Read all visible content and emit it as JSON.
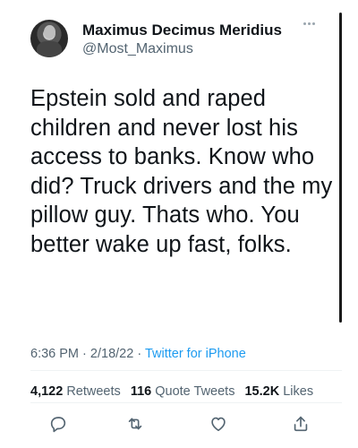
{
  "author": {
    "display_name": "Maximus Decimus Meridius",
    "handle": "@Most_Maximus"
  },
  "tweet": {
    "text": "Epstein sold and raped children and never lost his access to banks. Know who did? Truck drivers and the my pillow guy. Thats who. You better wake up fast, folks.",
    "time": "6:36 PM",
    "date": "2/18/22",
    "separator": "·",
    "source": "Twitter for iPhone"
  },
  "stats": {
    "retweets_count": "4,122",
    "retweets_label": "Retweets",
    "quote_tweets_count": "116",
    "quote_tweets_label": "Quote Tweets",
    "likes_count": "15.2K",
    "likes_label": "Likes"
  },
  "icons": {
    "reply": "reply-icon",
    "retweet": "retweet-icon",
    "like": "heart-icon",
    "share": "share-icon",
    "more": "more-icon"
  },
  "colors": {
    "text": "#0f1419",
    "secondary": "#536471",
    "link": "#1d9bf0",
    "divider": "#eff3f4"
  }
}
